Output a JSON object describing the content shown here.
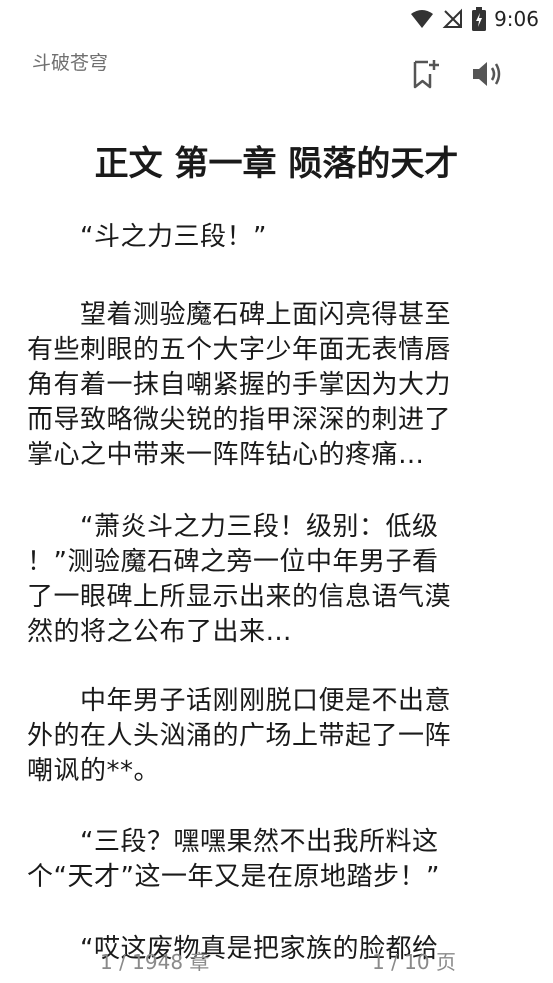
{
  "status_bar": {
    "time": "9:06",
    "icons": [
      "wifi-icon",
      "no-signal-icon",
      "battery-charging-icon"
    ]
  },
  "header": {
    "book_title": "斗破苍穹",
    "bookmark_icon": "bookmark-add-icon",
    "speaker_icon": "speaker-icon"
  },
  "chapter": {
    "title": "正文 第一章 陨落的天才"
  },
  "paragraphs": [
    {
      "lines": [
        "　　“斗之力三段！”"
      ]
    },
    {
      "lines": [
        "　　望着测验魔石碑上面闪亮得甚至",
        "有些刺眼的五个大字少年面无表情唇",
        "角有着一抹自嘲紧握的手掌因为大力",
        "而导致略微尖锐的指甲深深的刺进了",
        "掌心之中带来一阵阵钻心的疼痛…"
      ]
    },
    {
      "lines": [
        "　　“萧炎斗之力三段！级别：低级",
        "！”测验魔石碑之旁一位中年男子看",
        "了一眼碑上所显示出来的信息语气漠",
        "然的将之公布了出来…"
      ]
    },
    {
      "lines": [
        "　　中年男子话刚刚脱口便是不出意",
        "外的在人头汹涌的广场上带起了一阵",
        "嘲讽的**。"
      ]
    },
    {
      "lines": [
        "　　“三段？嘿嘿果然不出我所料这",
        "个“天才”这一年又是在原地踏步！”"
      ]
    },
    {
      "lines": [
        "　　“哎这废物真是把家族的脸都给"
      ]
    }
  ],
  "footer": {
    "chapter_progress": "1 / 1948 章",
    "page_progress": "1 / 10 页"
  }
}
